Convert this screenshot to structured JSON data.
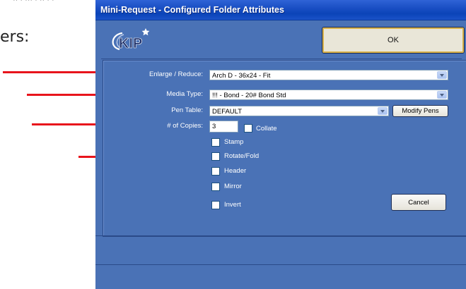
{
  "background": {
    "label": "ers:"
  },
  "window": {
    "title": "Mini-Request - Configured Folder Attributes",
    "ok_label": "OK",
    "logo_text": "KIP"
  },
  "form": {
    "enlarge_label": "Enlarge / Reduce:",
    "enlarge_value": "Arch D - 36x24 - Fit",
    "media_label": "Media Type:",
    "media_value": "!!! - Bond - 20# Bond Std",
    "pen_label": "Pen Table:",
    "pen_value": "DEFAULT",
    "modify_pens_label": "Modify Pens",
    "copies_label": "# of Copies:",
    "copies_value": "3",
    "collate_label": "Collate",
    "stamp_label": "Stamp",
    "rotate_label": "Rotate/Fold",
    "header_label": "Header",
    "mirror_label": "Mirror",
    "invert_label": "Invert",
    "cancel_label": "Cancel"
  },
  "colors": {
    "window_bg": "#4a72b6",
    "titlebar": "#1a4fc4",
    "arrow": "#e8141c"
  }
}
